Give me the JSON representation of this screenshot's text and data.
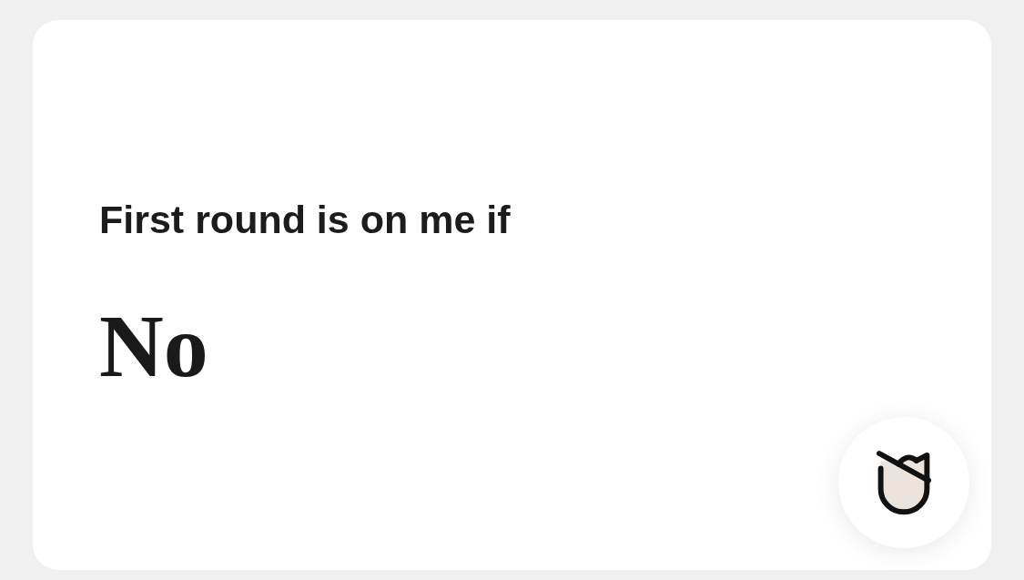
{
  "prompt": {
    "question": "First round is on me if",
    "answer": "No"
  }
}
